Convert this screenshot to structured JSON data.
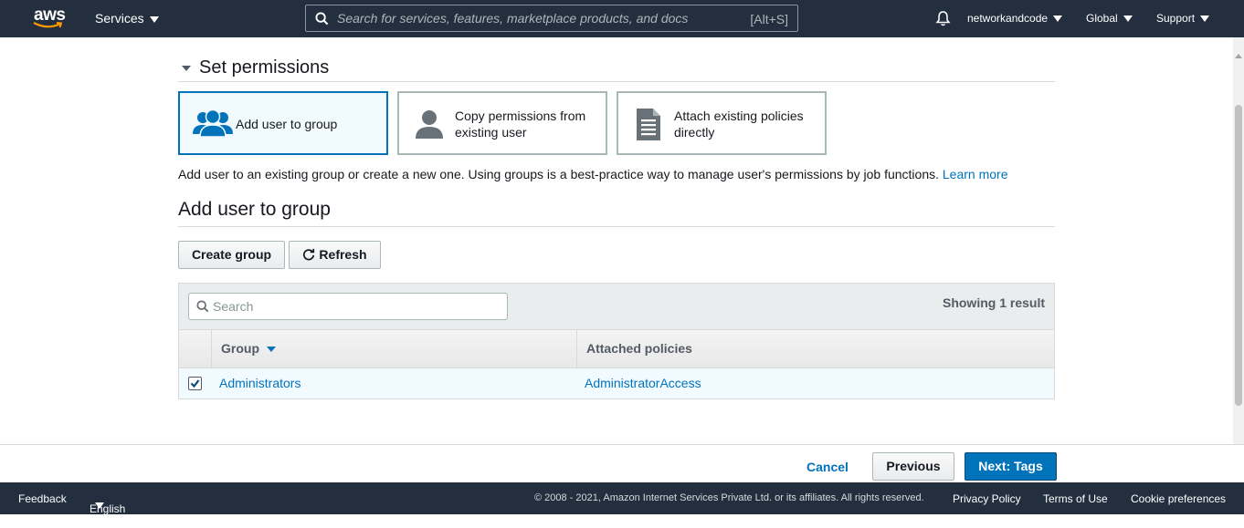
{
  "topnav": {
    "logo_text": "aws",
    "services_label": "Services",
    "search_placeholder": "Search for services, features, marketplace products, and docs",
    "search_shortcut": "[Alt+S]",
    "account_label": "networkandcode",
    "region_label": "Global",
    "support_label": "Support"
  },
  "permissions": {
    "section_title": "Set permissions",
    "options": [
      {
        "label": "Add user to group",
        "icon": "users-group-icon",
        "selected": true
      },
      {
        "label": "Copy permissions from existing user",
        "icon": "user-icon",
        "selected": false
      },
      {
        "label": "Attach existing policies directly",
        "icon": "document-icon",
        "selected": false
      }
    ],
    "description": "Add user to an existing group or create a new one. Using groups is a best-practice way to manage user's permissions by job functions.",
    "learn_more": "Learn more"
  },
  "group_section": {
    "title": "Add user to group",
    "create_group_label": "Create group",
    "refresh_label": "Refresh",
    "search_placeholder": "Search",
    "result_count": "Showing 1 result",
    "columns": [
      "Group",
      "Attached policies"
    ],
    "rows": [
      {
        "checked": true,
        "group": "Administrators",
        "policies": "AdministratorAccess"
      }
    ]
  },
  "wizard": {
    "cancel_label": "Cancel",
    "previous_label": "Previous",
    "next_label": "Next: Tags"
  },
  "footer": {
    "feedback": "Feedback",
    "language": "English (US)",
    "copyright": "© 2008 - 2021, Amazon Internet Services Private Ltd. or its affiliates. All rights reserved.",
    "privacy": "Privacy Policy",
    "terms": "Terms of Use",
    "cookies": "Cookie preferences"
  },
  "colors": {
    "nav_bg": "#232f3e",
    "link": "#0073bb",
    "primary_button": "#0073bb",
    "selected_bg": "#f1faff"
  }
}
